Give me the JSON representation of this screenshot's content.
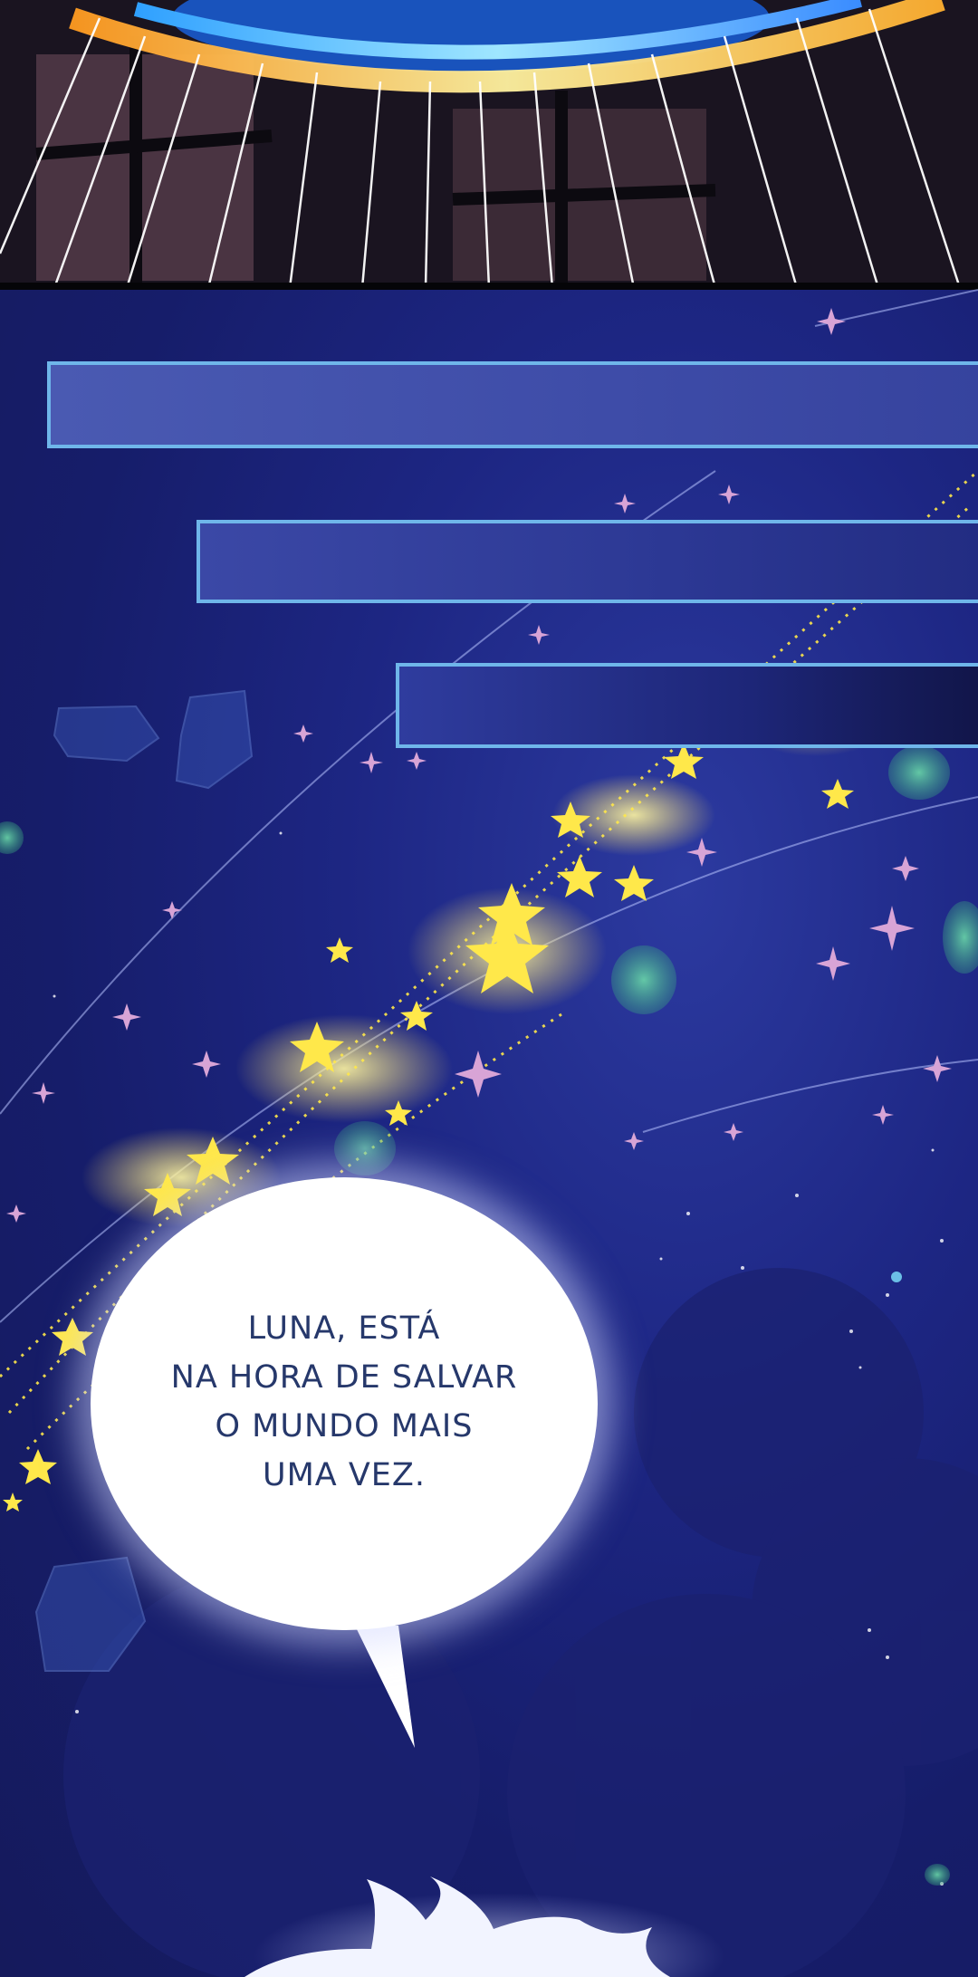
{
  "speech_bubble": {
    "lines": [
      "LUNA, ESTÁ",
      "NA HORA DE SALVAR",
      "O MUNDO MAIS",
      "UMA VEZ."
    ]
  },
  "colors": {
    "sky": "#1d2683",
    "bar_border": "#6fb6ea",
    "text": "#26386b",
    "star_gold": "#ffe84a"
  }
}
